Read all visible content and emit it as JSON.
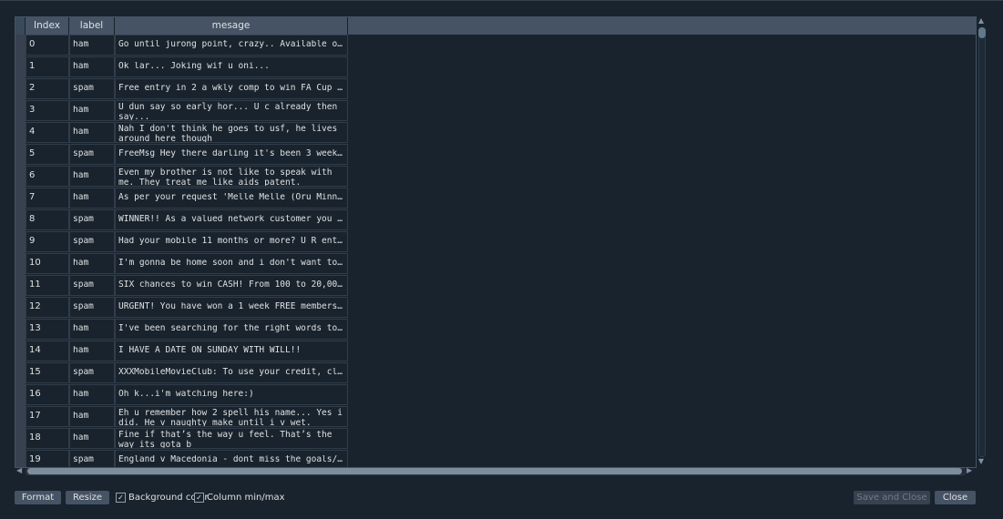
{
  "table": {
    "columns": [
      "Index",
      "label",
      "mesage"
    ],
    "rows": [
      {
        "index": "0",
        "label": "ham",
        "message": "Go until jurong point, crazy.. Available on…",
        "lines": 1
      },
      {
        "index": "1",
        "label": "ham",
        "message": "Ok lar... Joking wif u oni...",
        "lines": 1
      },
      {
        "index": "2",
        "label": "spam",
        "message": "Free entry in 2 a wkly comp to win FA Cup f…",
        "lines": 1
      },
      {
        "index": "3",
        "label": "ham",
        "message": "U dun say so early hor... U c already then say...",
        "lines": 2
      },
      {
        "index": "4",
        "label": "ham",
        "message": "Nah I don't think he goes to usf, he lives around here though",
        "lines": 2
      },
      {
        "index": "5",
        "label": "spam",
        "message": "FreeMsg Hey there darling it's been 3 week'…",
        "lines": 1
      },
      {
        "index": "6",
        "label": "ham",
        "message": "Even my brother is not like to speak with me. They treat me like aids patent.",
        "lines": 2
      },
      {
        "index": "7",
        "label": "ham",
        "message": "As per your request 'Melle Melle (Oru Minna…",
        "lines": 1
      },
      {
        "index": "8",
        "label": "spam",
        "message": "WINNER!! As a valued network customer you h…",
        "lines": 1
      },
      {
        "index": "9",
        "label": "spam",
        "message": "Had your mobile 11 months or more? U R enti…",
        "lines": 1
      },
      {
        "index": "10",
        "label": "ham",
        "message": "I'm gonna be home soon and i don't want to …",
        "lines": 1
      },
      {
        "index": "11",
        "label": "spam",
        "message": "SIX chances to win CASH! From 100 to 20,000…",
        "lines": 1
      },
      {
        "index": "12",
        "label": "spam",
        "message": "URGENT! You have won a 1 week FREE membersh…",
        "lines": 1
      },
      {
        "index": "13",
        "label": "ham",
        "message": "I've been searching for the right words to …",
        "lines": 1
      },
      {
        "index": "14",
        "label": "ham",
        "message": "I HAVE A DATE ON SUNDAY WITH WILL!!",
        "lines": 1
      },
      {
        "index": "15",
        "label": "spam",
        "message": "XXXMobileMovieClub: To use your credit, cli…",
        "lines": 1
      },
      {
        "index": "16",
        "label": "ham",
        "message": "Oh k...i'm watching here:)",
        "lines": 1
      },
      {
        "index": "17",
        "label": "ham",
        "message": "Eh u remember how 2 spell his name... Yes i did. He v naughty make until i v wet.",
        "lines": 2
      },
      {
        "index": "18",
        "label": "ham",
        "message": "Fine if that’s the way u feel. That’s the way its gota b",
        "lines": 2
      },
      {
        "index": "19",
        "label": "spam",
        "message": "England v Macedonia - dont miss the goals/t…",
        "lines": 1
      }
    ]
  },
  "buttons": {
    "format": "Format",
    "resize": "Resize",
    "save_close": "Save and Close",
    "close": "Close"
  },
  "checkboxes": {
    "background_color": {
      "label": "Background color",
      "checked": true
    },
    "column_minmax": {
      "label": "Column min/max",
      "checked": true
    }
  }
}
